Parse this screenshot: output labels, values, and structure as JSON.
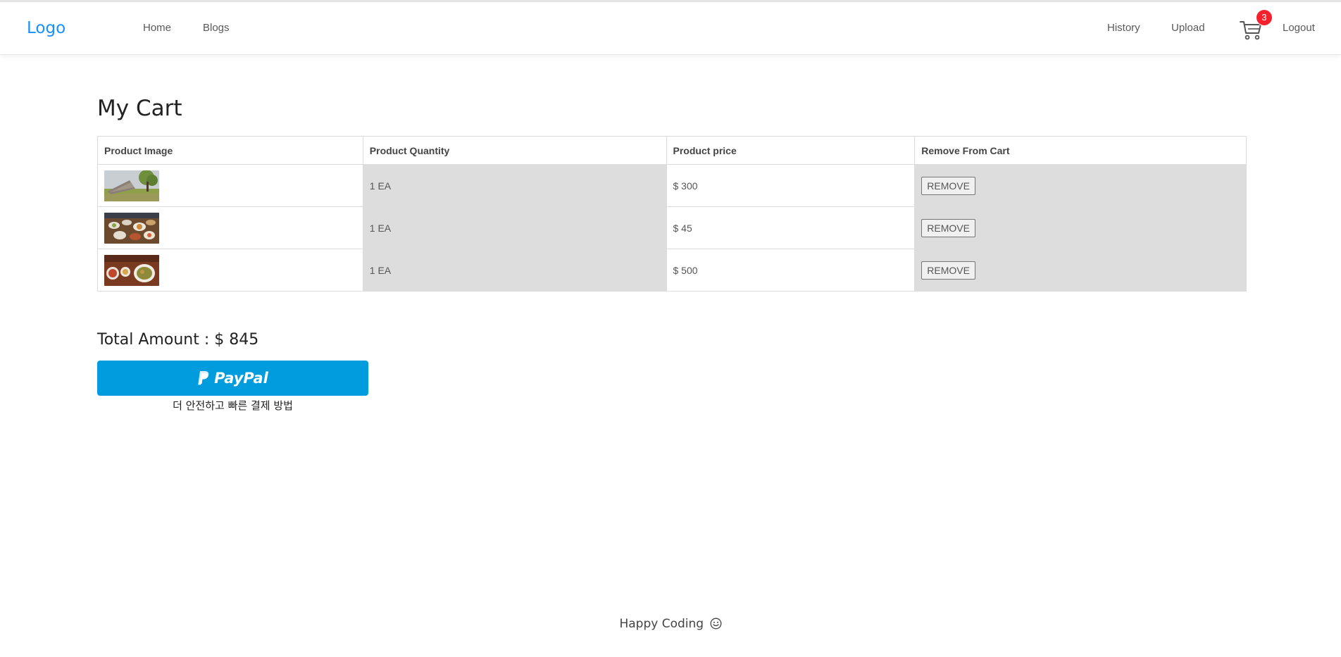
{
  "header": {
    "logo": "Logo",
    "nav_left": [
      "Home",
      "Blogs"
    ],
    "nav_right": [
      "History",
      "Upload",
      "Logout"
    ],
    "cart_badge": "3",
    "cart_icon": "shopping-cart-icon"
  },
  "main": {
    "title": "My Cart",
    "table": {
      "headers": [
        "Product Image",
        "Product Quantity",
        "Product price",
        "Remove From Cart"
      ],
      "rows": [
        {
          "image": "product-image-tree",
          "quantity": "1 EA",
          "price": "$ 300",
          "remove": "REMOVE"
        },
        {
          "image": "product-image-food-table",
          "quantity": "1 EA",
          "price": "$ 45",
          "remove": "REMOVE"
        },
        {
          "image": "product-image-food-dishes",
          "quantity": "1 EA",
          "price": "$ 500",
          "remove": "REMOVE"
        }
      ]
    },
    "total": "Total Amount : $ 845",
    "paypal": {
      "logo_text": "PayPal",
      "subtitle": "더 안전하고 빠른 결제 방법"
    }
  },
  "footer": {
    "text": "Happy Coding",
    "icon": "smile-icon"
  },
  "colors": {
    "accent": "#1890ff",
    "badge": "#f5222d",
    "paypal": "#009cde",
    "row_grey": "#dddddd"
  }
}
